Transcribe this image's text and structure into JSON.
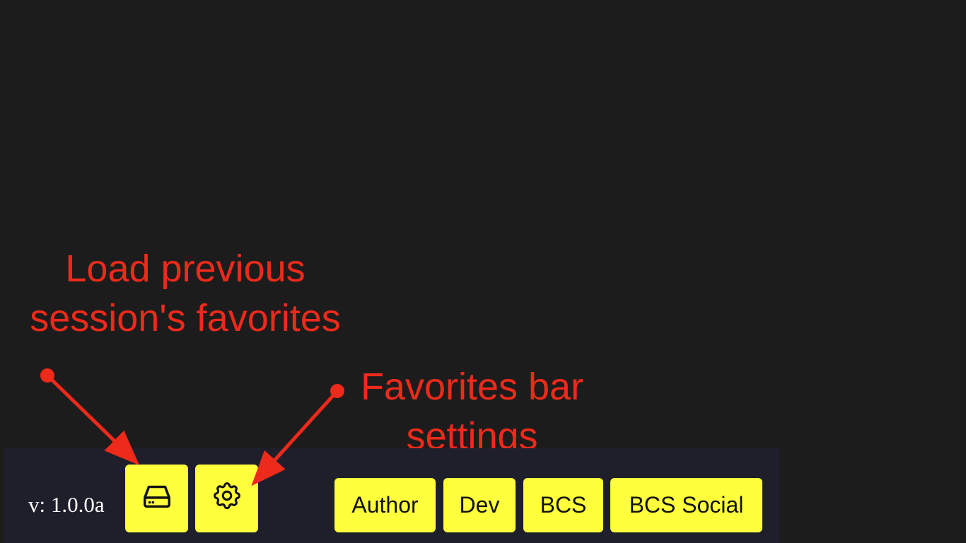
{
  "annotations": {
    "load_line1": "Load previous",
    "load_line2": "session's favorites",
    "settings_line1": "Favorites bar",
    "settings_line2": "settings",
    "color": "#ee2a1b"
  },
  "favorites_bar": {
    "version": "v: 1.0.0a",
    "load_icon": "hard-drive-icon",
    "settings_icon": "gear-icon",
    "favorites": [
      {
        "label": "Author"
      },
      {
        "label": "Dev"
      },
      {
        "label": "BCS"
      },
      {
        "label": "BCS Social"
      }
    ],
    "button_color": "#ffff3c",
    "background": "#1f1f2c"
  }
}
